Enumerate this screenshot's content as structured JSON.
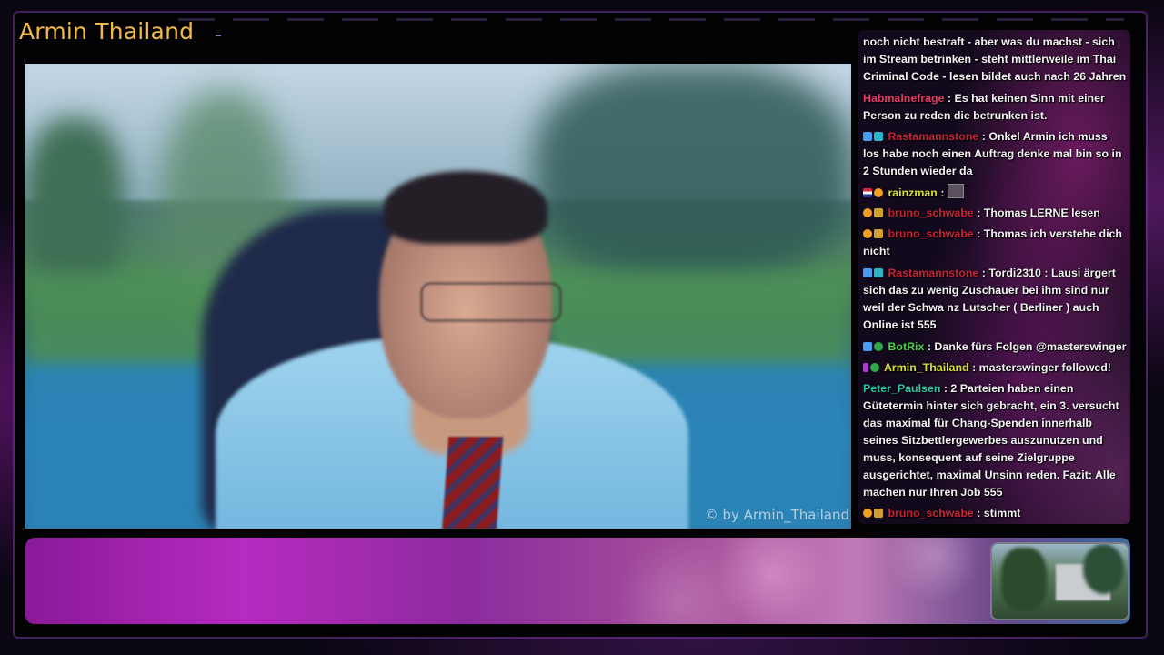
{
  "channel": {
    "title": "Armin Thailand",
    "watermark": "© by Armin_Thailand"
  },
  "colors": {
    "title": "#f2b84a",
    "frame_accent": "#8a1a9a"
  },
  "chat": {
    "messages": [
      {
        "user": "",
        "text": "noch nicht bestraft - aber was du machst - sich im Stream betrinken - steht mittlerweile im Thai Criminal Code - lesen bildet auch nach 26 Jahren",
        "badges": []
      },
      {
        "user": "Habmalnefrage",
        "text": ": Es hat keinen Sinn mit einer Person zu reden die betrunken ist.",
        "badges": []
      },
      {
        "user": "Rastamannstone",
        "text": ": Onkel Armin ich muss los habe noch einen Auftrag denke mal bin so in 2 Stunden wieder da",
        "badges": [
          "prime-icon",
          "sub-icon"
        ]
      },
      {
        "user": "rainzman",
        "text": ":",
        "badges": [
          "flag-icon",
          "gift-icon"
        ]
      },
      {
        "user": "bruno_schwabe",
        "text": ": Thomas LERNE lesen",
        "badges": [
          "gift-icon",
          "mod-icon"
        ]
      },
      {
        "user": "bruno_schwabe",
        "text": ": Thomas ich verstehe dich nicht",
        "badges": [
          "gift-icon",
          "mod-icon"
        ]
      },
      {
        "user": "Rastamannstone",
        "text": ": Tordi2310 : Lausi ärgert sich das zu wenig Zuschauer bei ihm sind nur weil der Schwa nz Lutscher ( Berliner ) auch Online ist 555",
        "badges": [
          "prime-icon",
          "sub-icon"
        ]
      },
      {
        "user": "BotRix",
        "text": ": Danke fürs Folgen @masterswinger",
        "badges": [
          "prime-icon",
          "check-icon"
        ]
      },
      {
        "user": "Armin_Thailand",
        "text": ": masterswinger followed!",
        "badges": [
          "broadcaster-icon",
          "check-icon"
        ]
      },
      {
        "user": "Peter_Paulsen",
        "text": ": 2 Parteien haben einen Gütetermin hinter sich gebracht, ein 3. versucht das maximal für Chang-Spenden innerhalb seines Sitzbettlergewerbes auszunutzen und muss, konsequent auf seine Zielgruppe ausgerichtet, maximal Unsinn reden. Fazit: Alle machen nur Ihren Job 555",
        "badges": []
      },
      {
        "user": "bruno_schwabe",
        "text": ": stimmt",
        "badges": [
          "gift-icon",
          "mod-icon"
        ]
      }
    ]
  }
}
